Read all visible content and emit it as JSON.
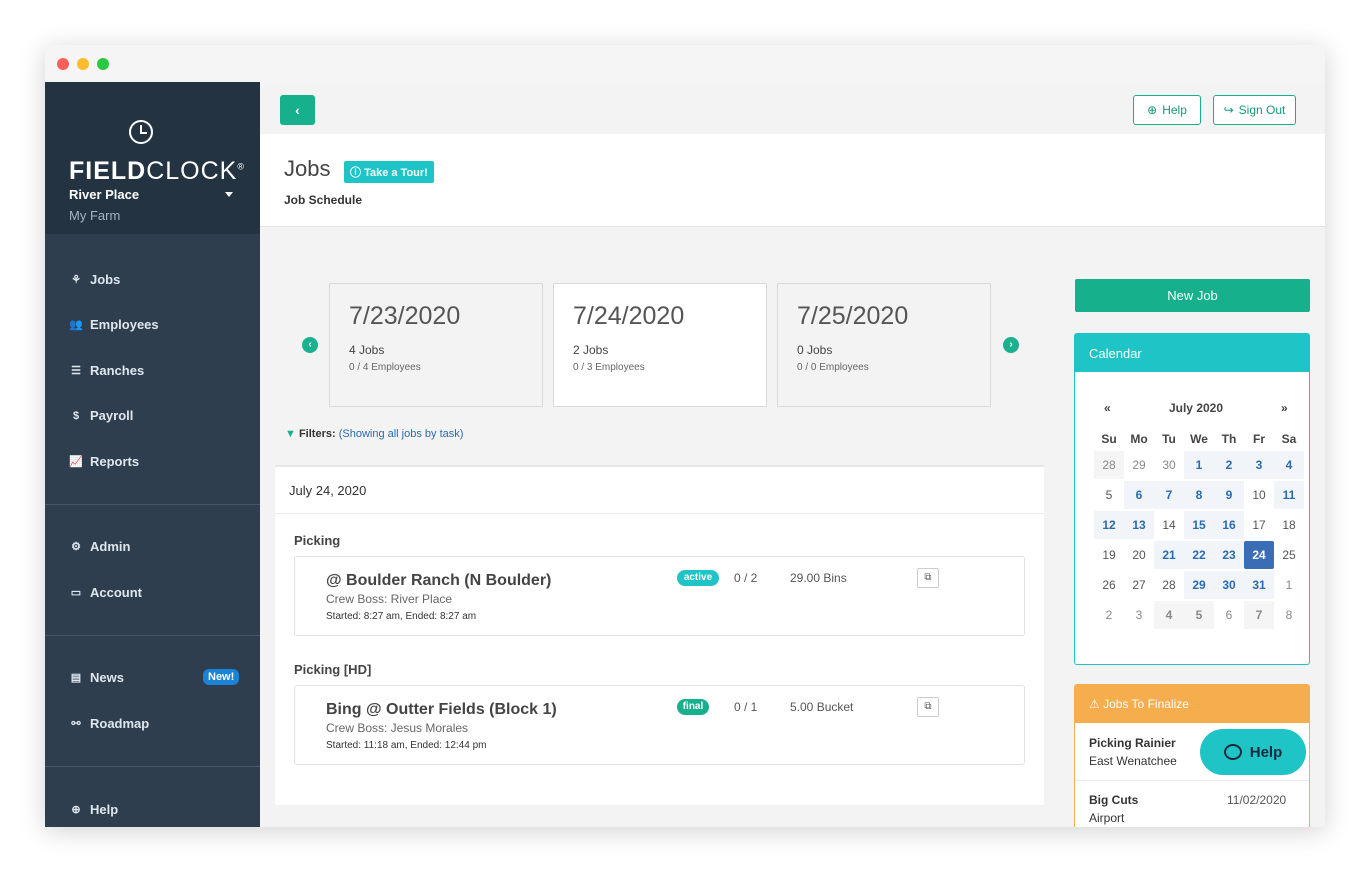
{
  "brand": {
    "logo_bold": "FIELD",
    "logo_light": "CLOCK",
    "logo_mark": "®",
    "farm": "River Place",
    "sub": "My Farm"
  },
  "nav": {
    "items": [
      {
        "label": "Jobs",
        "icon": "harvest-icon"
      },
      {
        "label": "Employees",
        "icon": "users-icon"
      },
      {
        "label": "Ranches",
        "icon": "farm-icon"
      },
      {
        "label": "Payroll",
        "icon": "dollar-icon"
      },
      {
        "label": "Reports",
        "icon": "chart-icon"
      },
      {
        "label": "Admin",
        "icon": "cogs-icon"
      },
      {
        "label": "Account",
        "icon": "card-icon"
      },
      {
        "label": "News",
        "icon": "newspaper-icon"
      },
      {
        "label": "Roadmap",
        "icon": "binoculars-icon"
      },
      {
        "label": "Help",
        "icon": "lifebuoy-icon"
      }
    ],
    "news_badge": "New!"
  },
  "topbar": {
    "back_glyph": "‹",
    "help_label": "Help",
    "signout_label": "Sign Out"
  },
  "header": {
    "title": "Jobs",
    "tour_label": "Take a Tour!",
    "subtitle": "Job Schedule"
  },
  "days": [
    {
      "date": "7/23/2020",
      "jobs": "4 Jobs",
      "employees": "0 / 4 Employees"
    },
    {
      "date": "7/24/2020",
      "jobs": "2 Jobs",
      "employees": "0 / 3 Employees"
    },
    {
      "date": "7/25/2020",
      "jobs": "0 Jobs",
      "employees": "0 / 0 Employees"
    }
  ],
  "filters": {
    "label": "Filters:",
    "value": "(Showing all jobs by task)"
  },
  "schedule": {
    "date_heading": "July 24, 2020",
    "tasks": [
      {
        "name": "Picking",
        "job": {
          "title": "@ Boulder Ranch (N Boulder)",
          "boss": "Crew Boss: River Place",
          "time": "Started: 8:27 am, Ended: 8:27 am",
          "status": "active",
          "count": "0 / 2",
          "units": "29.00 Bins"
        }
      },
      {
        "name": "Picking [HD]",
        "job": {
          "title": "Bing @ Outter Fields (Block 1)",
          "boss": "Crew Boss: Jesus Morales",
          "time": "Started: 11:18 am, Ended: 12:44 pm",
          "status": "final",
          "count": "0 / 1",
          "units": "5.00 Bucket"
        }
      }
    ]
  },
  "right": {
    "new_job": "New Job",
    "calendar_title": "Calendar",
    "month": "July 2020",
    "prev": "«",
    "next": "»",
    "dow": [
      "Su",
      "Mo",
      "Tu",
      "We",
      "Th",
      "Fr",
      "Sa"
    ],
    "weeks": [
      [
        "28",
        "29",
        "30",
        "1",
        "2",
        "3",
        "4"
      ],
      [
        "5",
        "6",
        "7",
        "8",
        "9",
        "10",
        "11"
      ],
      [
        "12",
        "13",
        "14",
        "15",
        "16",
        "17",
        "18"
      ],
      [
        "19",
        "20",
        "21",
        "22",
        "23",
        "24",
        "25"
      ],
      [
        "26",
        "27",
        "28",
        "29",
        "30",
        "31",
        "1"
      ],
      [
        "2",
        "3",
        "4",
        "5",
        "6",
        "7",
        "8"
      ]
    ],
    "finalize_title": "Jobs To Finalize",
    "finalize": [
      {
        "name": "Picking Rainier",
        "location": "East Wenatchee",
        "date": ""
      },
      {
        "name": "Big Cuts",
        "location": "Airport",
        "date": "11/02/2020"
      }
    ],
    "help_fab": "Help"
  },
  "colors": {
    "accent": "#16b08c",
    "cyan": "#1ec4c6",
    "sidebar": "#2e3e4e",
    "orange": "#f6ad4e",
    "link": "#2a6bb0"
  }
}
